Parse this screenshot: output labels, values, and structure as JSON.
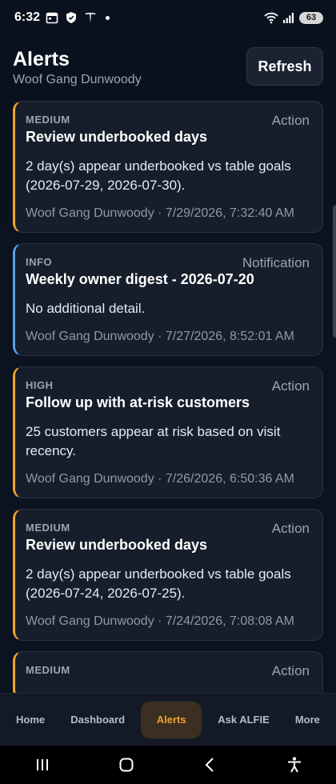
{
  "status_bar": {
    "time": "6:32",
    "battery": "63",
    "icons": [
      "calendar-icon",
      "shield-icon",
      "tesla-icon",
      "wifi-icon",
      "signal-icon",
      "battery-icon"
    ]
  },
  "header": {
    "title": "Alerts",
    "subtitle": "Woof Gang Dunwoody",
    "refresh_label": "Refresh"
  },
  "alerts": [
    {
      "severity": "MEDIUM",
      "kind": "Action",
      "title": "Review underbooked days",
      "body": "2 day(s) appear underbooked vs table goals (2026-07-29, 2026-07-30).",
      "meta": "Woof Gang Dunwoody · 7/29/2026, 7:32:40 AM",
      "accent": "#f0a32a"
    },
    {
      "severity": "INFO",
      "kind": "Notification",
      "title": "Weekly owner digest - 2026-07-20",
      "body": "No additional detail.",
      "meta": "Woof Gang Dunwoody · 7/27/2026, 8:52:01 AM",
      "accent": "#5b9ee6"
    },
    {
      "severity": "HIGH",
      "kind": "Action",
      "title": "Follow up with at-risk customers",
      "body": "25 customers appear at risk based on visit recency.",
      "meta": "Woof Gang Dunwoody · 7/26/2026, 6:50:36 AM",
      "accent": "#f0a32a"
    },
    {
      "severity": "MEDIUM",
      "kind": "Action",
      "title": "Review underbooked days",
      "body": "2 day(s) appear underbooked vs table goals (2026-07-24, 2026-07-25).",
      "meta": "Woof Gang Dunwoody · 7/24/2026, 7:08:08 AM",
      "accent": "#f0a32a"
    },
    {
      "severity": "MEDIUM",
      "kind": "Action",
      "title": "",
      "body": "",
      "meta": "",
      "accent": "#f0a32a"
    }
  ],
  "nav": {
    "items": [
      "Home",
      "Dashboard",
      "Alerts",
      "Ask ALFIE",
      "More"
    ],
    "active": "Alerts",
    "active_color": "#f0a32a"
  }
}
